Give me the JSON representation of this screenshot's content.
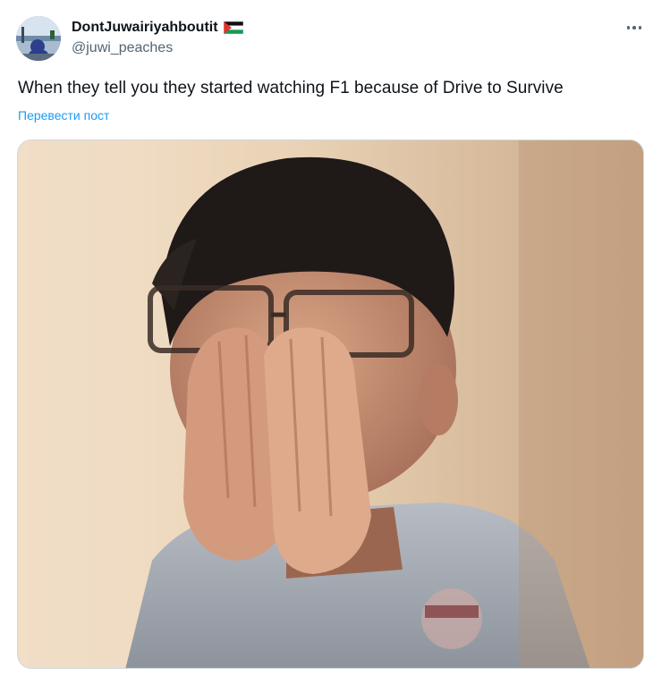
{
  "tweet": {
    "author": {
      "display_name": "DontJuwairiyahboutit",
      "handle": "@juwi_peaches",
      "flag_icon": "palestine-flag-icon",
      "avatar_icon": "avatar"
    },
    "more_icon": "more-horizontal-icon",
    "text": "When they tell you they started watching F1 because of Drive to Survive",
    "translate_label": "Перевести пост",
    "media_icon": "meme-photo",
    "colors": {
      "text": "#0f1419",
      "secondary": "#536471",
      "link": "#1d9bf0",
      "border": "#cfd9de"
    }
  }
}
